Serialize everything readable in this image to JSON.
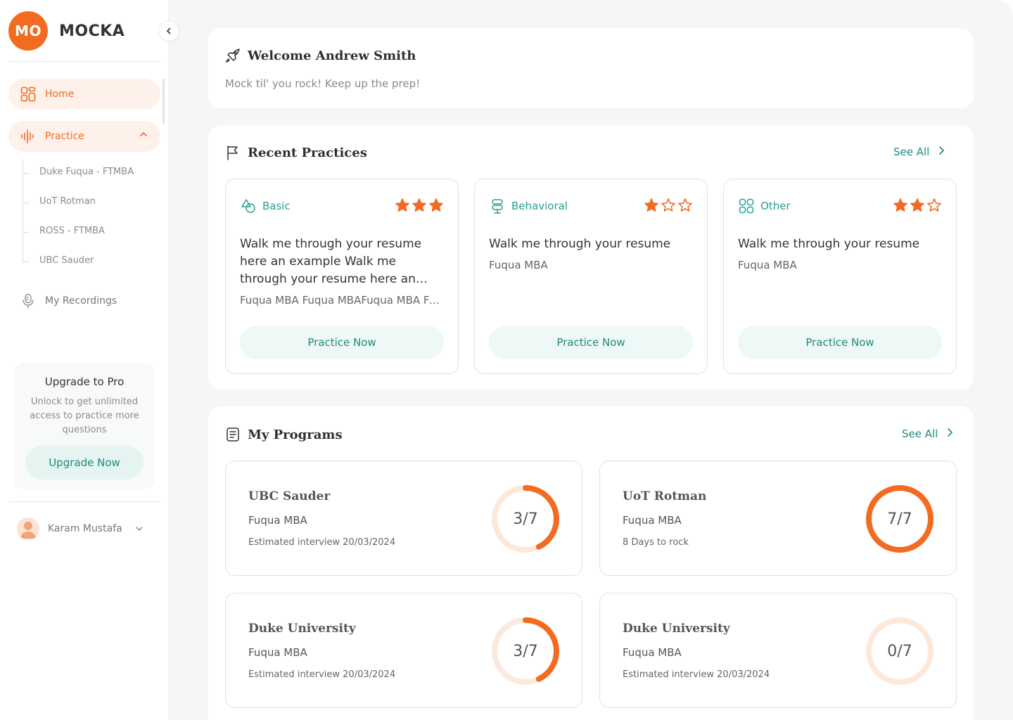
{
  "brand": {
    "badge": "MO",
    "name": "MOCKA",
    "accent": "#f26b21",
    "teal": "#1f8a7c"
  },
  "sidebar": {
    "home_label": "Home",
    "practice_label": "Practice",
    "sub_items": [
      "Duke Fuqua - FTMBA",
      "UoT Rotman",
      "ROSS - FTMBA",
      "UBC Sauder"
    ],
    "recordings_label": "My Recordings",
    "upgrade": {
      "title": "Upgrade to Pro",
      "text": "Unlock to get unlimited access to practice more questions",
      "button": "Upgrade Now"
    },
    "user_name": "Karam Mustafa"
  },
  "welcome": {
    "title": "Welcome  Andrew Smith",
    "subtitle": "Mock til' you rock! Keep up the prep!"
  },
  "recent": {
    "title": "Recent Practices",
    "see_all": "See All",
    "cards": [
      {
        "tag": "Basic",
        "rating": 3,
        "question": "Walk me through your resume here an example Walk me through your resume here an example",
        "program": "Fuqua MBA Fuqua MBAFuqua MBA Fuqua MBA",
        "button": "Practice Now"
      },
      {
        "tag": "Behavioral",
        "rating": 1,
        "question": "Walk me through your resume",
        "program": "Fuqua MBA",
        "button": "Practice Now"
      },
      {
        "tag": "Other",
        "rating": 2,
        "question": "Walk me through your resume",
        "program": "Fuqua MBA",
        "button": "Practice Now"
      }
    ]
  },
  "programs": {
    "title": "My Programs",
    "see_all": "See All",
    "items": [
      {
        "school": "UBC Sauder",
        "program": "Fuqua MBA",
        "meta": "Estimated interview 20/03/2024",
        "done": 3,
        "total": 7,
        "progress_label": "3/7"
      },
      {
        "school": "UoT Rotman",
        "program": "Fuqua MBA",
        "meta": "8 Days to rock",
        "done": 7,
        "total": 7,
        "progress_label": "7/7"
      },
      {
        "school": "Duke University",
        "program": "Fuqua MBA",
        "meta": "Estimated interview 20/03/2024",
        "done": 3,
        "total": 7,
        "progress_label": "3/7"
      },
      {
        "school": "Duke University",
        "program": "Fuqua MBA",
        "meta": "Estimated interview 20/03/2024",
        "done": 0,
        "total": 7,
        "progress_label": "0/7"
      }
    ]
  }
}
